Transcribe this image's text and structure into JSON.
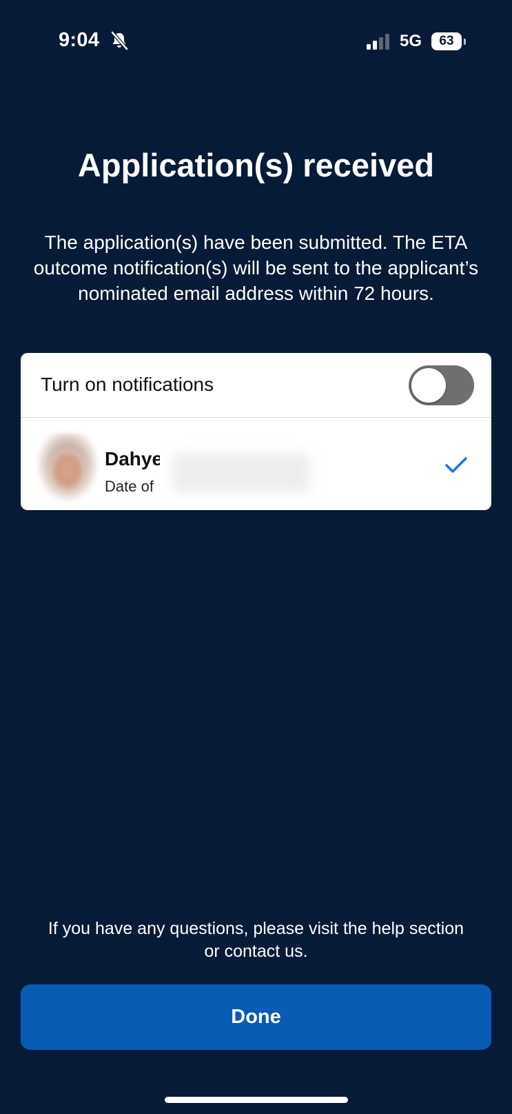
{
  "status_bar": {
    "time": "9:04",
    "network": "5G",
    "battery": "63"
  },
  "page": {
    "title": "Application(s) received",
    "message": "The application(s) have been submitted. The ETA outcome notification(s) will be sent to the applicant’s nominated email address within 72 hours."
  },
  "card": {
    "notifications_label": "Turn on notifications",
    "notifications_on": false,
    "applicant": {
      "name": "Dahye",
      "dob_label": "Date of",
      "selected": true
    }
  },
  "footer": {
    "help_text": "If you have any questions, please visit the help section or contact us.",
    "done_label": "Done"
  },
  "colors": {
    "background": "#061b37",
    "accent": "#0a5bb4",
    "check": "#1479dc",
    "toggle_off": "#6f6f6f"
  },
  "icons": {
    "silent": "bell-slash-icon",
    "signal": "cellular-signal-icon",
    "selected": "checkmark-icon"
  }
}
